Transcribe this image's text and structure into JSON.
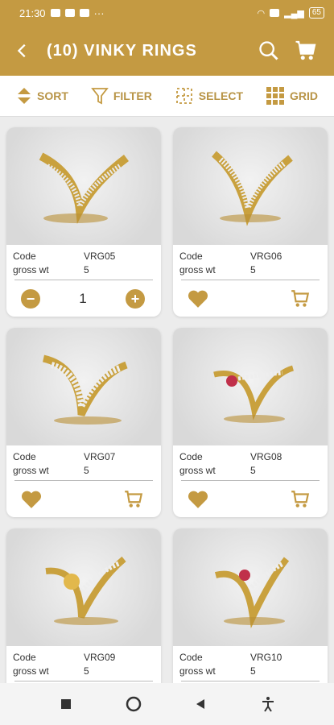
{
  "status": {
    "time": "21:30",
    "battery": "65"
  },
  "appbar": {
    "title": "(10) VINKY RINGS"
  },
  "toolbar": {
    "sort": "SORT",
    "filter": "FILTER",
    "select": "SELECT",
    "grid": "GRID"
  },
  "labels": {
    "code": "Code",
    "gross": "gross wt"
  },
  "products": [
    {
      "code": "VRG05",
      "gross": "5",
      "qty": "1"
    },
    {
      "code": "VRG06",
      "gross": "5"
    },
    {
      "code": "VRG07",
      "gross": "5"
    },
    {
      "code": "VRG08",
      "gross": "5"
    },
    {
      "code": "VRG09",
      "gross": "5"
    },
    {
      "code": "VRG10",
      "gross": "5"
    }
  ],
  "colors": {
    "accent": "#c49a42"
  }
}
